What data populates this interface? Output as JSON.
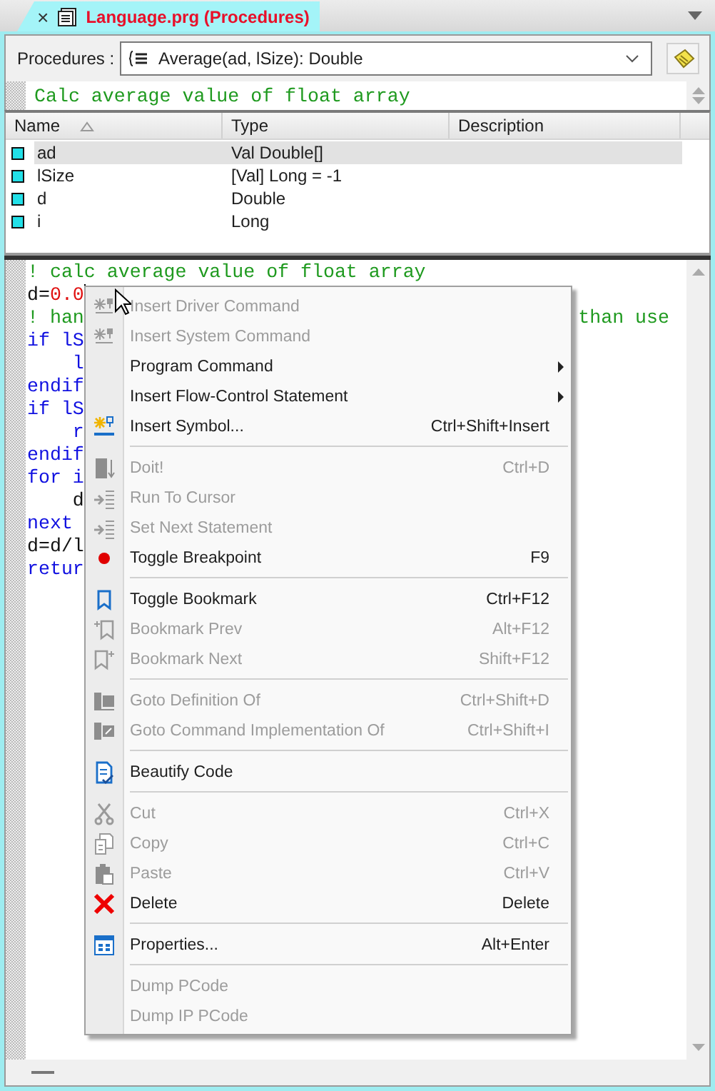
{
  "tab": {
    "title": "Language.prg (Procedures)",
    "close": "×",
    "selected": true
  },
  "toolbar": {
    "label": "Procedures :",
    "combo_value": "Average(ad, lSize): Double"
  },
  "description": "Calc average value of float array",
  "table": {
    "columns": [
      {
        "label": "Name",
        "sorted": true
      },
      {
        "label": "Type",
        "sorted": false
      },
      {
        "label": "Description",
        "sorted": false
      }
    ],
    "rows": [
      {
        "name": "ad",
        "type": "Val Double[]",
        "selected": true
      },
      {
        "name": "lSize",
        "type": "[Val] Long = -1",
        "selected": false
      },
      {
        "name": "d",
        "type": "Double",
        "selected": false
      },
      {
        "name": "i",
        "type": "Long",
        "selected": false
      }
    ]
  },
  "code": [
    {
      "segments": [
        {
          "text": "! calc average value of float array",
          "kind": "comment"
        }
      ]
    },
    {
      "segments": [
        {
          "text": "d=",
          "kind": "plain"
        },
        {
          "text": "0.0",
          "kind": "number"
        }
      ],
      "caret": true
    },
    {
      "segments": [
        {
          "text": "! han",
          "kind": "comment"
        }
      ],
      "tail": {
        "text": "than use",
        "kind": "comment"
      }
    },
    {
      "segments": [
        {
          "text": "if lS",
          "kind": "keyword"
        }
      ]
    },
    {
      "segments": [
        {
          "text": "    l",
          "kind": "keyword"
        }
      ]
    },
    {
      "segments": [
        {
          "text": "endif",
          "kind": "keyword"
        }
      ]
    },
    {
      "segments": [
        {
          "text": "if lS",
          "kind": "keyword"
        }
      ]
    },
    {
      "segments": [
        {
          "text": "    r",
          "kind": "keyword"
        }
      ]
    },
    {
      "segments": [
        {
          "text": "endif",
          "kind": "keyword"
        }
      ]
    },
    {
      "segments": [
        {
          "text": "for i",
          "kind": "keyword"
        }
      ]
    },
    {
      "segments": [
        {
          "text": "    d",
          "kind": "plain"
        }
      ]
    },
    {
      "segments": [
        {
          "text": "next",
          "kind": "keyword"
        }
      ]
    },
    {
      "segments": [
        {
          "text": "d=d/l",
          "kind": "plain"
        }
      ]
    },
    {
      "segments": [
        {
          "text": "retur",
          "kind": "keyword"
        }
      ]
    }
  ],
  "menu": [
    {
      "kind": "item",
      "label": "Insert Driver Command",
      "disabled": true
    },
    {
      "kind": "item",
      "label": "Insert System Command",
      "disabled": true
    },
    {
      "kind": "item",
      "label": "Program Command",
      "disabled": false,
      "submenu": true
    },
    {
      "kind": "item",
      "label": "Insert Flow-Control Statement",
      "disabled": false,
      "submenu": true
    },
    {
      "kind": "item",
      "label": "Insert Symbol...",
      "shortcut": "Ctrl+Shift+Insert",
      "disabled": false
    },
    {
      "kind": "separator"
    },
    {
      "kind": "item",
      "label": "Doit!",
      "shortcut": "Ctrl+D",
      "disabled": true
    },
    {
      "kind": "item",
      "label": "Run To Cursor",
      "disabled": true
    },
    {
      "kind": "item",
      "label": "Set Next Statement",
      "disabled": true
    },
    {
      "kind": "item",
      "label": "Toggle Breakpoint",
      "shortcut": "F9",
      "disabled": false
    },
    {
      "kind": "separator"
    },
    {
      "kind": "item",
      "label": "Toggle Bookmark",
      "shortcut": "Ctrl+F12",
      "disabled": false
    },
    {
      "kind": "item",
      "label": "Bookmark Prev",
      "shortcut": "Alt+F12",
      "disabled": true
    },
    {
      "kind": "item",
      "label": "Bookmark Next",
      "shortcut": "Shift+F12",
      "disabled": true
    },
    {
      "kind": "separator"
    },
    {
      "kind": "item",
      "label": "Goto Definition Of",
      "shortcut": "Ctrl+Shift+D",
      "disabled": true
    },
    {
      "kind": "item",
      "label": "Goto Command Implementation Of",
      "shortcut": "Ctrl+Shift+I",
      "disabled": true
    },
    {
      "kind": "separator"
    },
    {
      "kind": "item",
      "label": "Beautify Code",
      "disabled": false
    },
    {
      "kind": "separator"
    },
    {
      "kind": "item",
      "label": "Cut",
      "shortcut": "Ctrl+X",
      "disabled": true
    },
    {
      "kind": "item",
      "label": "Copy",
      "shortcut": "Ctrl+C",
      "disabled": true
    },
    {
      "kind": "item",
      "label": "Paste",
      "shortcut": "Ctrl+V",
      "disabled": true
    },
    {
      "kind": "item",
      "label": "Delete",
      "shortcut": "Delete",
      "disabled": false
    },
    {
      "kind": "separator"
    },
    {
      "kind": "item",
      "label": "Properties...",
      "shortcut": "Alt+Enter",
      "disabled": false
    },
    {
      "kind": "separator"
    },
    {
      "kind": "item",
      "label": "Dump PCode",
      "disabled": true
    },
    {
      "kind": "item",
      "label": "Dump IP PCode",
      "disabled": true
    }
  ]
}
